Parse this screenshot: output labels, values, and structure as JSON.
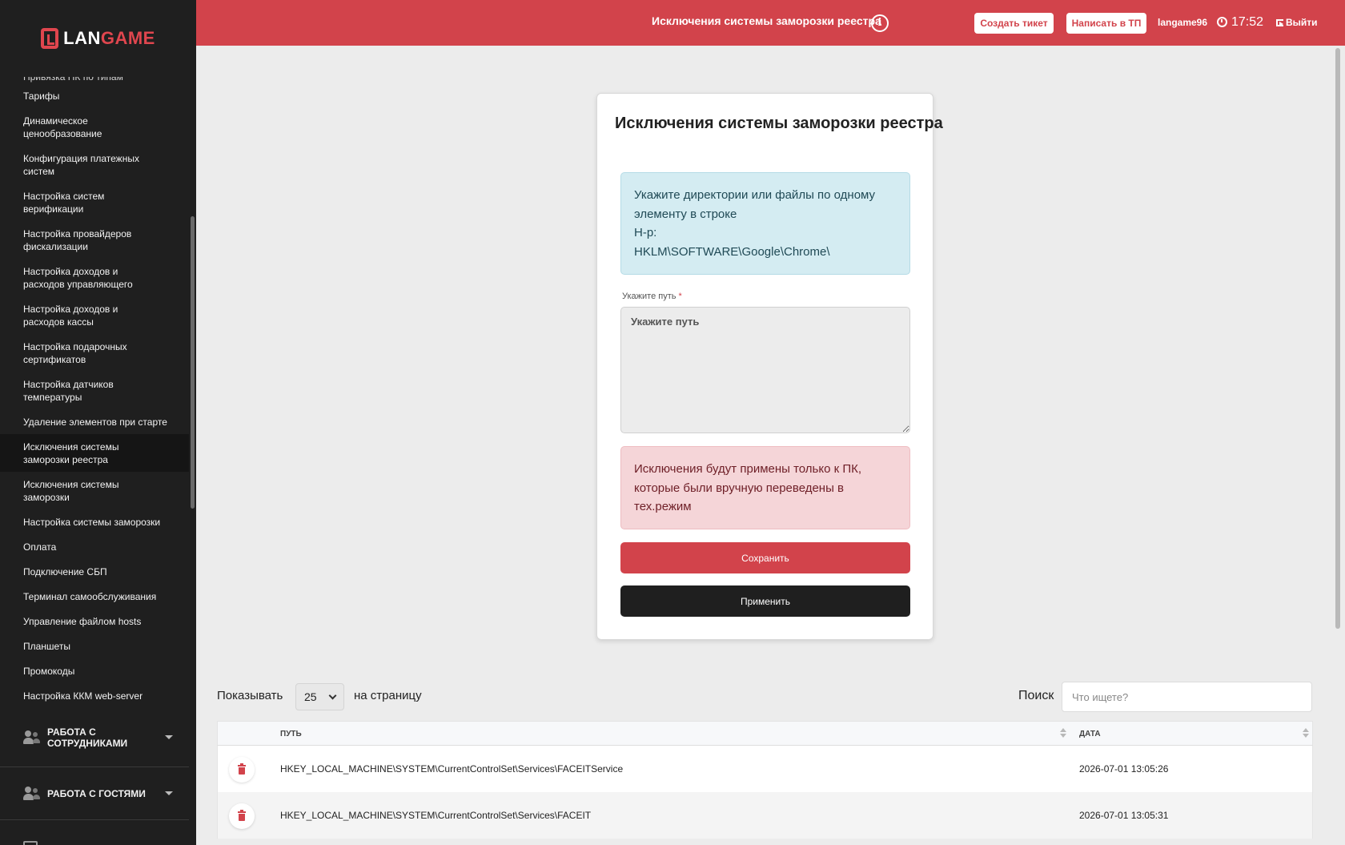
{
  "brand": {
    "logo_prefix": "LAN",
    "logo_suffix": "GAME"
  },
  "sidebar": {
    "items": [
      {
        "label": "Привязка ПК по типам",
        "lines": "cut"
      },
      {
        "label": "Тарифы",
        "lines": "one"
      },
      {
        "label": "Динамическое ценообразование",
        "lines": "two"
      },
      {
        "label": "Конфигурация платежных систем",
        "lines": "two"
      },
      {
        "label": "Настройка систем верификации",
        "lines": "two"
      },
      {
        "label": "Настройка провайдеров фискализации",
        "lines": "two"
      },
      {
        "label": "Настройка доходов и расходов управляющего",
        "lines": "two"
      },
      {
        "label": "Настройка доходов и расходов кассы",
        "lines": "two"
      },
      {
        "label": "Настройка подарочных сертификатов",
        "lines": "two"
      },
      {
        "label": "Настройка датчиков температуры",
        "lines": "two"
      },
      {
        "label": "Удаление элементов при старте",
        "lines": "one"
      },
      {
        "label": "Исключения системы заморозки реестра",
        "lines": "two",
        "active": true
      },
      {
        "label": "Исключения системы заморозки",
        "lines": "two"
      },
      {
        "label": "Настройка системы заморозки",
        "lines": "one"
      },
      {
        "label": "Оплата",
        "lines": "one"
      },
      {
        "label": "Подключение СБП",
        "lines": "one"
      },
      {
        "label": "Терминал самообслуживания",
        "lines": "one"
      },
      {
        "label": "Управление файлом hosts",
        "lines": "one"
      },
      {
        "label": "Планшеты",
        "lines": "one"
      },
      {
        "label": "Промокоды",
        "lines": "one"
      },
      {
        "label": "Настройка ККМ web-server",
        "lines": "one"
      }
    ],
    "sections": [
      {
        "label": "Работа с сотрудниками",
        "icon": "users-icon"
      },
      {
        "label": "Работа с гостями",
        "icon": "users-icon"
      }
    ]
  },
  "topbar": {
    "title": "Исключения системы заморозки реестра",
    "create_ticket": "Создать тикет",
    "write_support": "Написать в ТП",
    "username": "langame96",
    "time": "17:52",
    "logout": "Выйти"
  },
  "form": {
    "title": "Исключения системы заморозки реестра",
    "info_lines": [
      "Укажите директории или файлы по одному",
      "элементу в строке",
      "Н-р:",
      "HKLM\\SOFTWARE\\Google\\Chrome\\"
    ],
    "path_label": "Укажите путь",
    "path_required_mark": "*",
    "path_placeholder": "Укажите путь",
    "path_value": "",
    "warning_lines": [
      "Исключения будут примены только к ПК,",
      "которые были вручную переведены в",
      "тех.режим"
    ],
    "save_label": "Сохранить",
    "apply_label": "Применить"
  },
  "table_controls": {
    "show_label": "Показывать",
    "per_page_value": "25",
    "per_page_suffix": "на страницу",
    "search_label": "Поиск",
    "search_placeholder": "Что ищете?",
    "search_value": ""
  },
  "table": {
    "columns": [
      "ПУТЬ",
      "ДАТА"
    ],
    "rows": [
      {
        "path": "HKEY_LOCAL_MACHINE\\SYSTEM\\CurrentControlSet\\Services\\FACEITService",
        "date": "2026-07-01 13:05:26"
      },
      {
        "path": "HKEY_LOCAL_MACHINE\\SYSTEM\\CurrentControlSet\\Services\\FACEIT",
        "date": "2026-07-01 13:05:31"
      }
    ]
  },
  "colors": {
    "accent": "#d2434b",
    "sidebar_bg": "#1f1f1f",
    "info_bg": "#d4ecf2",
    "danger_bg": "#f5d5d8"
  }
}
